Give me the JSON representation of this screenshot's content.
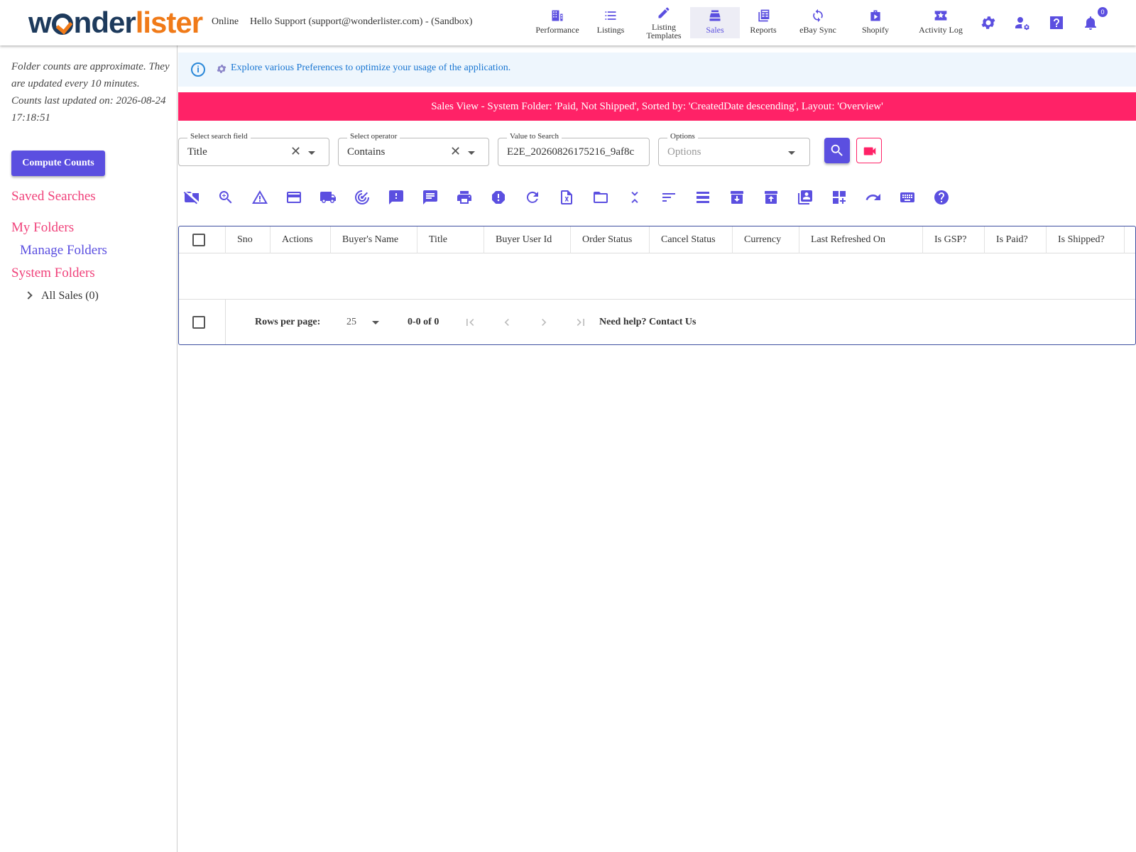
{
  "header": {
    "logo_part1": "w",
    "logo_part2": "nder",
    "logo_part3": "lister",
    "status": "Online",
    "greeting": "Hello Support (support@wonderlister.com) - (Sandbox)",
    "nav": [
      {
        "label": "Performance",
        "icon": "building-icon"
      },
      {
        "label": "Listings",
        "icon": "list-icon"
      },
      {
        "label": "Listing Templates",
        "icon": "pencil-icon"
      },
      {
        "label": "Sales",
        "icon": "cash-register-icon",
        "active": true
      },
      {
        "label": "Reports",
        "icon": "reports-icon"
      },
      {
        "label": "eBay Sync",
        "icon": "sync-icon"
      },
      {
        "label": "Shopify",
        "icon": "shopify-bag-icon"
      },
      {
        "label": "Activity Log",
        "icon": "activity-log-icon"
      }
    ],
    "notification_count": "0",
    "accent_color": "#5b4fe0"
  },
  "sidebar": {
    "note_line1": "Folder counts are approximate. They are updated every 10 minutes.",
    "note_line2": "Counts last updated on: 2026-08-24 17:18:51",
    "compute_button": "Compute Counts",
    "saved_searches": "Saved Searches",
    "my_folders": "My Folders",
    "manage_folders": "Manage Folders",
    "system_folders": "System Folders",
    "all_sales": "All Sales (0)"
  },
  "info": {
    "text": "Explore various Preferences to optimize your usage of the application."
  },
  "banner": {
    "text": "Sales View - System Folder: 'Paid, Not Shipped', Sorted by: 'CreatedDate descending', Layout: 'Overview'",
    "color": "#ff2267"
  },
  "search": {
    "field_label": "Select search field",
    "field_value": "Title",
    "operator_label": "Select operator",
    "operator_value": "Contains",
    "value_label": "Value to Search",
    "value_value": "E2E_20260826175216_9af8c",
    "options_label": "Options",
    "options_placeholder": "Options"
  },
  "toolbar_icons": [
    "hide-folder-icon",
    "zoom-search-icon",
    "warning-icon",
    "payment-card-icon",
    "shipping-truck-icon",
    "tracking-radar-icon",
    "feedback-alert-icon",
    "message-icon",
    "print-icon",
    "dispute-icon",
    "refresh-icon",
    "excel-export-icon",
    "folder-icon",
    "collapse-icon",
    "sort-icon",
    "density-icon",
    "archive-icon",
    "unarchive-icon",
    "bulk-copy-icon",
    "add-widget-icon",
    "redo-icon",
    "keyboard-icon",
    "help-icon"
  ],
  "grid": {
    "columns": [
      "Sno",
      "Actions",
      "Buyer's Name",
      "Title",
      "Buyer User Id",
      "Order Status",
      "Cancel Status",
      "Currency",
      "Last Refreshed On",
      "Is GSP?",
      "Is Paid?",
      "Is Shipped?"
    ],
    "rows_per_page_label": "Rows per page:",
    "rows_per_page_value": "25",
    "range": "0-0 of 0",
    "help": "Need help? Contact Us"
  }
}
